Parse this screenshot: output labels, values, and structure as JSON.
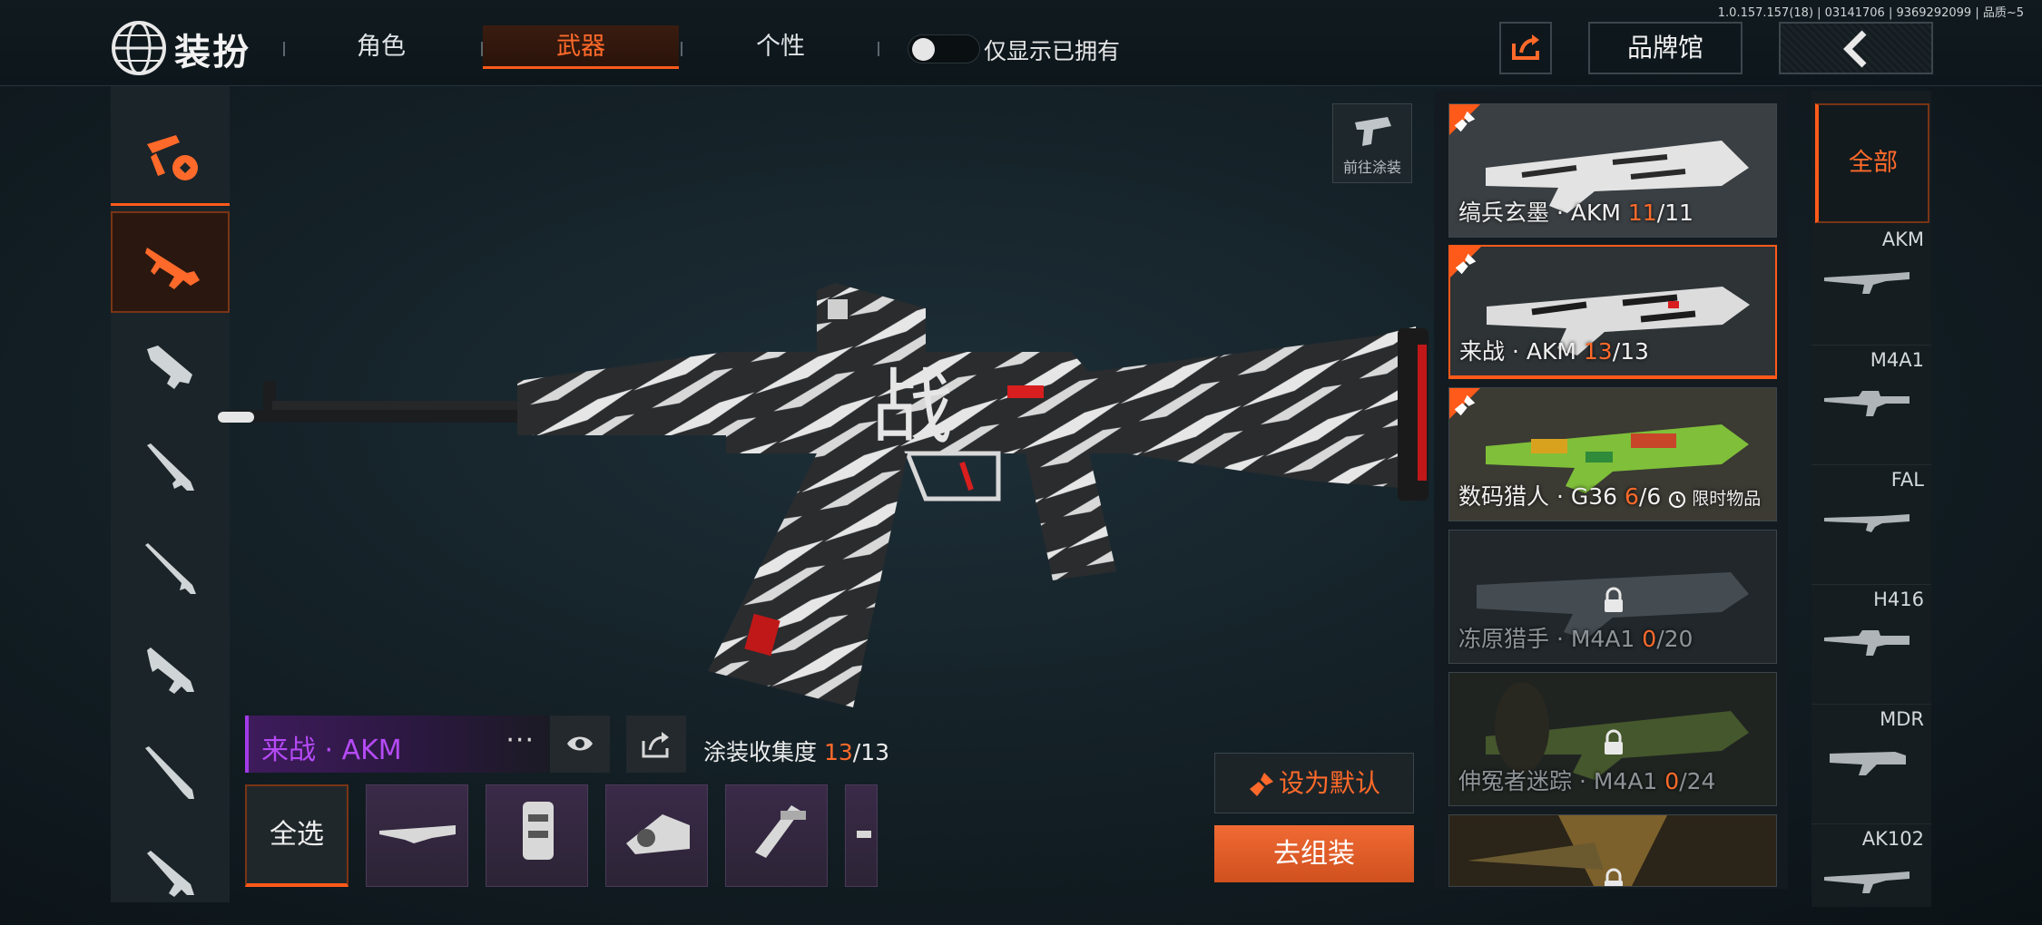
{
  "version_info": "1.0.157.157(18) | 03141706 | 9369292099 | 品质~5",
  "header": {
    "title": "装扮",
    "tabs": [
      {
        "label": "角色",
        "active": false
      },
      {
        "label": "武器",
        "active": true
      },
      {
        "label": "个性",
        "active": false
      }
    ],
    "toggle_label": "仅显示已拥有",
    "toggle_on": false,
    "brand_button": "品牌馆"
  },
  "categories": [
    {
      "icon": "all-weapons-icon",
      "active": false
    },
    {
      "icon": "assault-rifle-icon",
      "active": true
    },
    {
      "icon": "smg-icon",
      "active": false
    },
    {
      "icon": "shotgun-icon",
      "active": false
    },
    {
      "icon": "sniper-rifle-icon",
      "active": false
    },
    {
      "icon": "dmr-icon",
      "active": false
    },
    {
      "icon": "bolt-rifle-icon",
      "active": false
    },
    {
      "icon": "lmg-icon",
      "active": false
    }
  ],
  "stage": {
    "goto_paint": "前往涂装"
  },
  "selected_skin": {
    "name": "来战 · AKM",
    "more": "···",
    "collection_label": "涂装收集度",
    "collected": "13",
    "total": "/13"
  },
  "parts": {
    "select_all": "全选",
    "items": [
      "full-gun-part",
      "grip-part",
      "sight-part",
      "stock-part",
      "muzzle-part"
    ]
  },
  "actions": {
    "set_default": "设为默认",
    "assemble": "去组装"
  },
  "skins": [
    {
      "name": "缟兵玄墨 · AKM",
      "owned": "11",
      "total": "/11",
      "selected": false,
      "locked": false,
      "tag": "",
      "colors": [
        "#d8d8d8",
        "#2a2a2a"
      ]
    },
    {
      "name": "来战 · AKM",
      "owned": "13",
      "total": "/13",
      "selected": true,
      "locked": false,
      "tag": "",
      "colors": [
        "#e6e6e6",
        "#1f1f1f"
      ]
    },
    {
      "name": "数码猎人 · G36",
      "owned": "6",
      "total": "/6",
      "selected": false,
      "locked": false,
      "tag": "限时物品",
      "colors": [
        "#7fbf3a",
        "#d9a21e"
      ]
    },
    {
      "name": "冻原猎手 · M4A1",
      "owned": "0",
      "total": "/20",
      "selected": false,
      "locked": true,
      "tag": "",
      "colors": [
        "#9aa4ad",
        "#5a646d"
      ]
    },
    {
      "name": "伸冤者迷踪 · M4A1",
      "owned": "0",
      "total": "/24",
      "selected": false,
      "locked": true,
      "tag": "",
      "colors": [
        "#6f8a3a",
        "#2f3a22"
      ]
    },
    {
      "name": "",
      "owned": "",
      "total": "",
      "selected": false,
      "locked": true,
      "tag": "",
      "colors": [
        "#b48a3a",
        "#2b2418"
      ]
    }
  ],
  "weapon_filter": {
    "all_label": "全部",
    "items": [
      "AKM",
      "M4A1",
      "FAL",
      "H416",
      "MDR",
      "AK102"
    ]
  },
  "accent_color": "#ff5a1a"
}
